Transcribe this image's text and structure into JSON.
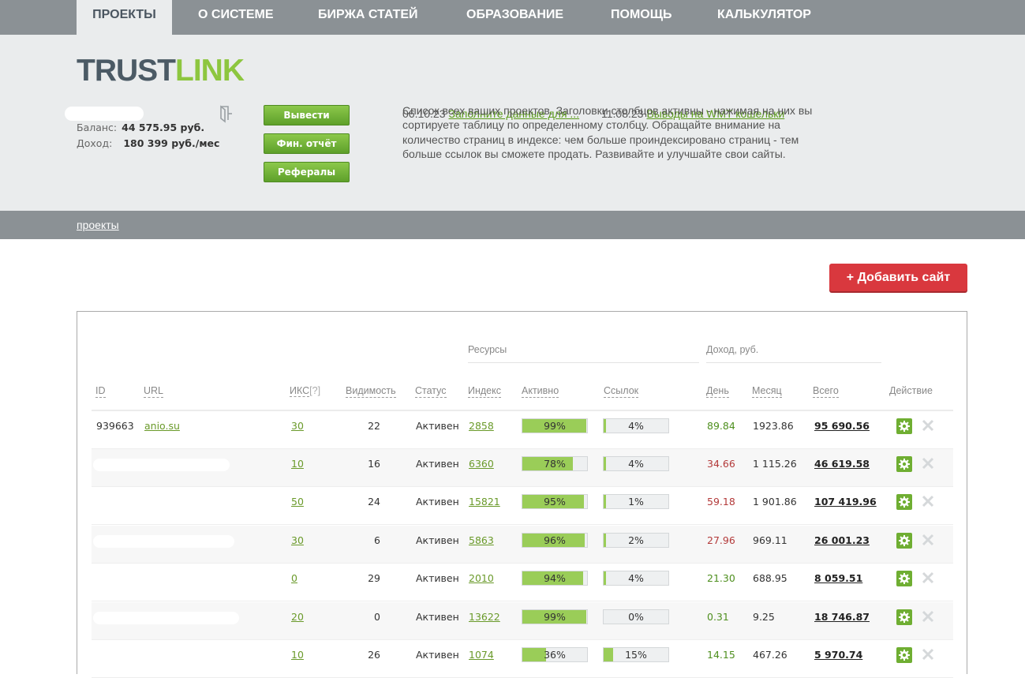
{
  "nav": {
    "items": [
      "ПРОЕКТЫ",
      "О СИСТЕМЕ",
      "БИРЖА СТАТЕЙ",
      "ОБРАЗОВАНИЕ",
      "ПОМОЩЬ",
      "КАЛЬКУЛЯТОР"
    ]
  },
  "logo": {
    "part1": "TRUST",
    "part2": "LINK"
  },
  "account": {
    "balance_label": "Баланс:",
    "balance_value": "44 575.95  руб.",
    "income_label": "Доход:",
    "income_value": "180 399 руб./мес"
  },
  "buttons": {
    "withdraw": "Вывести",
    "report": "Фин. отчёт",
    "referrals": "Рефералы",
    "add_site": "+ Добавить сайт"
  },
  "news": [
    {
      "date": "06.10.23",
      "text": "Заполните данные для ..."
    },
    {
      "date": "11.08.23",
      "text": "Выводы на WMT кошельки"
    }
  ],
  "description": "Список всех ваших проектов. Заголовки столбцов активны - нажимая на них вы сортируете таблицу по определенному столбцу. Обращайте внимание на количество страниц в индексе: чем больше проиндексировано страниц - тем больше ссылок вы сможете продать. Развивайте и улучшайте свои сайты.",
  "breadcrumb": "проекты",
  "table": {
    "group_resources": "Ресурсы",
    "group_income": "Доход,  руб.",
    "columns": {
      "id": "ID",
      "url": "URL",
      "iks": "ИКС",
      "iks_q": "[?]",
      "visibility": "Видимость",
      "status": "Статус",
      "index": "Индекс",
      "active": "Активно",
      "links": "Ссылок",
      "day": "День",
      "month": "Месяц",
      "total": "Всего",
      "action": "Действие"
    },
    "rows": [
      {
        "id": "939663",
        "url": "anio.su",
        "iks": "30",
        "vis": "22",
        "status": "Активен",
        "index": "2858",
        "active": "99%",
        "active_pct": 99,
        "links": "4%",
        "links_pct": 4,
        "day": "89.84",
        "day_color": "green",
        "month": "1923.86",
        "total": "95 690.56"
      },
      {
        "id": "",
        "url": "",
        "iks": "10",
        "vis": "16",
        "status": "Активен",
        "index": "6360",
        "active": "78%",
        "active_pct": 78,
        "links": "4%",
        "links_pct": 4,
        "day": "34.66",
        "day_color": "red",
        "month": "1 115.26",
        "total": "46 619.58"
      },
      {
        "id": "",
        "url": "",
        "iks": "50",
        "vis": "24",
        "status": "Активен",
        "index": "15821",
        "active": "95%",
        "active_pct": 95,
        "links": "1%",
        "links_pct": 1,
        "day": "59.18",
        "day_color": "red",
        "month": "1 901.86",
        "total": "107 419.96"
      },
      {
        "id": "",
        "url": "",
        "iks": "30",
        "vis": "6",
        "status": "Активен",
        "index": "5863",
        "active": "96%",
        "active_pct": 96,
        "links": "2%",
        "links_pct": 2,
        "day": "27.96",
        "day_color": "red",
        "month": "969.11",
        "total": "26 001.23"
      },
      {
        "id": "",
        "url": "",
        "iks": "0",
        "vis": "29",
        "status": "Активен",
        "index": "2010",
        "active": "94%",
        "active_pct": 94,
        "links": "4%",
        "links_pct": 4,
        "day": "21.30",
        "day_color": "green",
        "month": "688.95",
        "total": "8 059.51"
      },
      {
        "id": "",
        "url": "",
        "iks": "20",
        "vis": "0",
        "status": "Активен",
        "index": "13622",
        "active": "99%",
        "active_pct": 99,
        "links": "0%",
        "links_pct": 0,
        "day": "0.31",
        "day_color": "green",
        "month": "9.25",
        "total": "18 746.87"
      },
      {
        "id": "",
        "url": "",
        "iks": "10",
        "vis": "26",
        "status": "Активен",
        "index": "1074",
        "active": "36%",
        "active_pct": 36,
        "links": "15%",
        "links_pct": 15,
        "day": "14.15",
        "day_color": "green",
        "month": "467.26",
        "total": "5 970.74"
      }
    ]
  },
  "colors": {
    "accent_green": "#8dc63f",
    "nav_gray": "#8b9195",
    "add_red": "#d9383e"
  },
  "icons": {
    "exit": "exit-door-icon",
    "settings": "gear-icon",
    "delete": "close-icon"
  }
}
